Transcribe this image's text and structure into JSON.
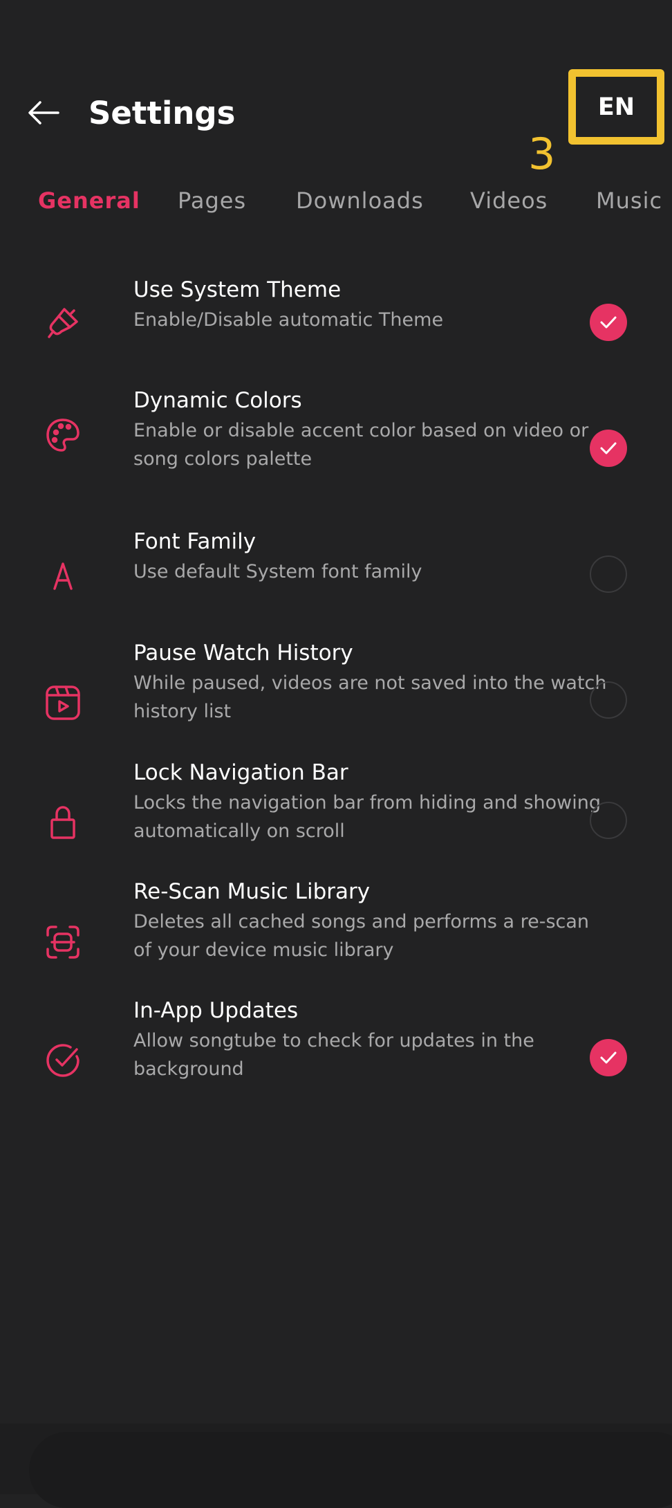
{
  "header": {
    "title": "Settings",
    "back_icon": "arrow-left-icon",
    "language_button": "EN",
    "marker_number": "3"
  },
  "tabs": [
    {
      "label": "General",
      "active": true
    },
    {
      "label": "Pages",
      "active": false
    },
    {
      "label": "Downloads",
      "active": false
    },
    {
      "label": "Videos",
      "active": false
    },
    {
      "label": "Music P",
      "active": false
    }
  ],
  "settings": [
    {
      "icon": "paint-brush-icon",
      "title": "Use System Theme",
      "subtitle": "Enable/Disable automatic Theme",
      "checked": true
    },
    {
      "icon": "palette-icon",
      "title": "Dynamic Colors",
      "subtitle": "Enable or disable accent color based on video or song colors palette",
      "checked": true
    },
    {
      "icon": "font-letter-icon",
      "title": "Font Family",
      "subtitle": "Use default System font family",
      "checked": false
    },
    {
      "icon": "video-play-icon",
      "title": "Pause Watch History",
      "subtitle": "While paused, videos are not saved into the watch history list",
      "checked": false
    },
    {
      "icon": "lock-icon",
      "title": "Lock Navigation Bar",
      "subtitle": "Locks the navigation bar from hiding and showing automatically on scroll",
      "checked": false
    },
    {
      "icon": "scan-icon",
      "title": "Re-Scan Music Library",
      "subtitle": "Deletes all cached songs and performs a re-scan of your device music library",
      "checked": null
    },
    {
      "icon": "check-circle-icon",
      "title": "In-App Updates",
      "subtitle": "Allow songtube to check for updates in the background",
      "checked": true
    }
  ],
  "colors": {
    "accent": "#e63363",
    "background": "#222223",
    "highlight": "#f2c230"
  }
}
